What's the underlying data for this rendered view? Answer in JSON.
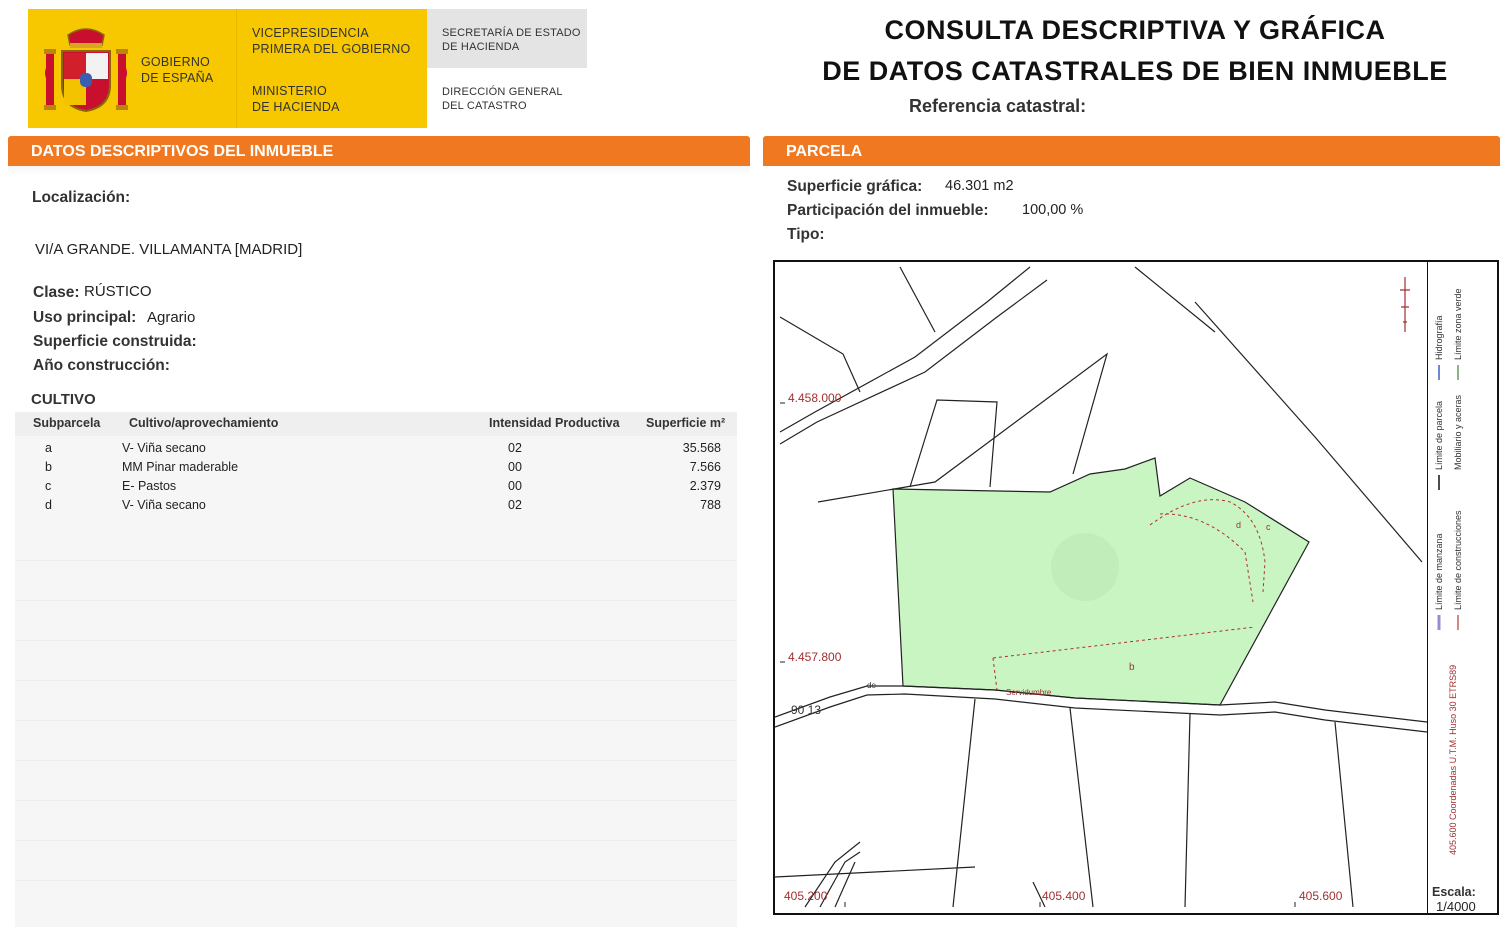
{
  "header": {
    "gobierno": [
      "GOBIERNO",
      "DE ESPAÑA"
    ],
    "vicepresidencia": [
      "VICEPRESIDENCIA",
      "PRIMERA DEL GOBIERNO"
    ],
    "ministerio": [
      "MINISTERIO",
      "DE HACIENDA"
    ],
    "secretaria": [
      "SECRETARÍA DE ESTADO",
      "DE HACIENDA"
    ],
    "direccion": [
      "DIRECCIÓN GENERAL",
      "DEL CATASTRO"
    ],
    "title_line1": "CONSULTA DESCRIPTIVA Y GRÁFICA",
    "title_line2": "DE DATOS CATASTRALES DE BIEN INMUEBLE",
    "ref_label": "Referencia catastral:"
  },
  "left": {
    "section_title": "DATOS DESCRIPTIVOS DEL INMUEBLE",
    "localizacion_label": "Localización:",
    "localizacion_value": "VI/A GRANDE. VILLAMANTA [MADRID]",
    "clase_label": "Clase:",
    "clase_value": "RÚSTICO",
    "uso_label": "Uso principal:",
    "uso_value": "Agrario",
    "superficie_label": "Superficie construida:",
    "anio_label": "Año construcción:",
    "cultivo_title": "CULTIVO",
    "table": {
      "headers": [
        "Subparcela",
        "Cultivo/aprovechamiento",
        "Intensidad Productiva",
        "Superficie m²"
      ],
      "rows": [
        [
          "a",
          "V- Viña secano",
          "02",
          "35.568"
        ],
        [
          "b",
          "MM Pinar maderable",
          "00",
          "7.566"
        ],
        [
          "c",
          "E- Pastos",
          "00",
          "2.379"
        ],
        [
          "d",
          "V- Viña secano",
          "02",
          "788"
        ]
      ]
    }
  },
  "right": {
    "section_title": "PARCELA",
    "sup_label": "Superficie gráfica:",
    "sup_value": "46.301 m2",
    "part_label": "Participación del inmueble:",
    "part_value": "100,00 %",
    "tipo_label": "Tipo:"
  },
  "map": {
    "coord_y1": "4.458.000",
    "coord_y2": "4.457.800",
    "coord_x1": "405.200",
    "coord_x2": "405.400",
    "coord_x3": "405.600",
    "road_label": "90 13",
    "sub_b": "b",
    "sub_c": "c",
    "sub_d": "d",
    "sub_de": "de",
    "serv_label": "Servidumbre",
    "escala_label": "Escala:",
    "escala_value": "1/4000",
    "legend": {
      "hidrografia": "Hidrografía",
      "zona_verde": "Límite zona verde",
      "parcela": "Límite de parcela",
      "mobiliario": "Mobiliario y aceras",
      "manzana": "Límite de manzana",
      "construcciones": "Límite de construcciones",
      "coords": "405.600 Coordenadas U.T.M. Huso 30 ETRS89"
    },
    "colors": {
      "parcel_fill": "#c9f5c3",
      "accent_orange": "#f07820",
      "coord_red": "#a03030"
    }
  }
}
